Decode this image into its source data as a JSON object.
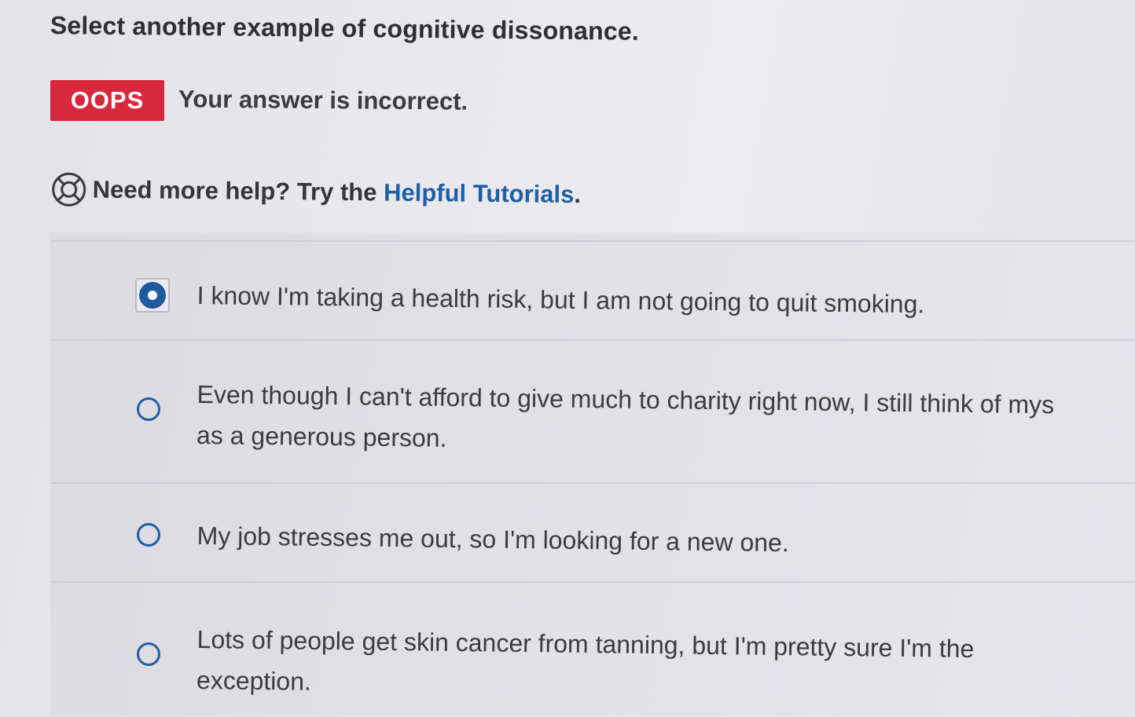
{
  "question": "Select another example of cognitive dissonance.",
  "feedback": {
    "badge": "OOPS",
    "message": "Your answer is incorrect."
  },
  "help": {
    "prefix": "Need more help? Try the ",
    "link_label": "Helpful Tutorials",
    "suffix": "."
  },
  "options": [
    {
      "line1": "I know I'm taking a health risk, but I am not going to quit smoking.",
      "line2": "",
      "selected": true
    },
    {
      "line1": "Even though I can't afford to give much to charity right now, I still think of mys",
      "line2": "as a generous person.",
      "selected": false
    },
    {
      "line1": "My job stresses me out, so I'm looking for a new one.",
      "line2": "",
      "selected": false
    },
    {
      "line1": "Lots of people get skin cancer from tanning, but I'm pretty sure I'm the",
      "line2": "exception.",
      "selected": false
    }
  ],
  "colors": {
    "badge": "#d8283e",
    "link": "#1f5fa6",
    "radio": "#1f5fa6"
  }
}
